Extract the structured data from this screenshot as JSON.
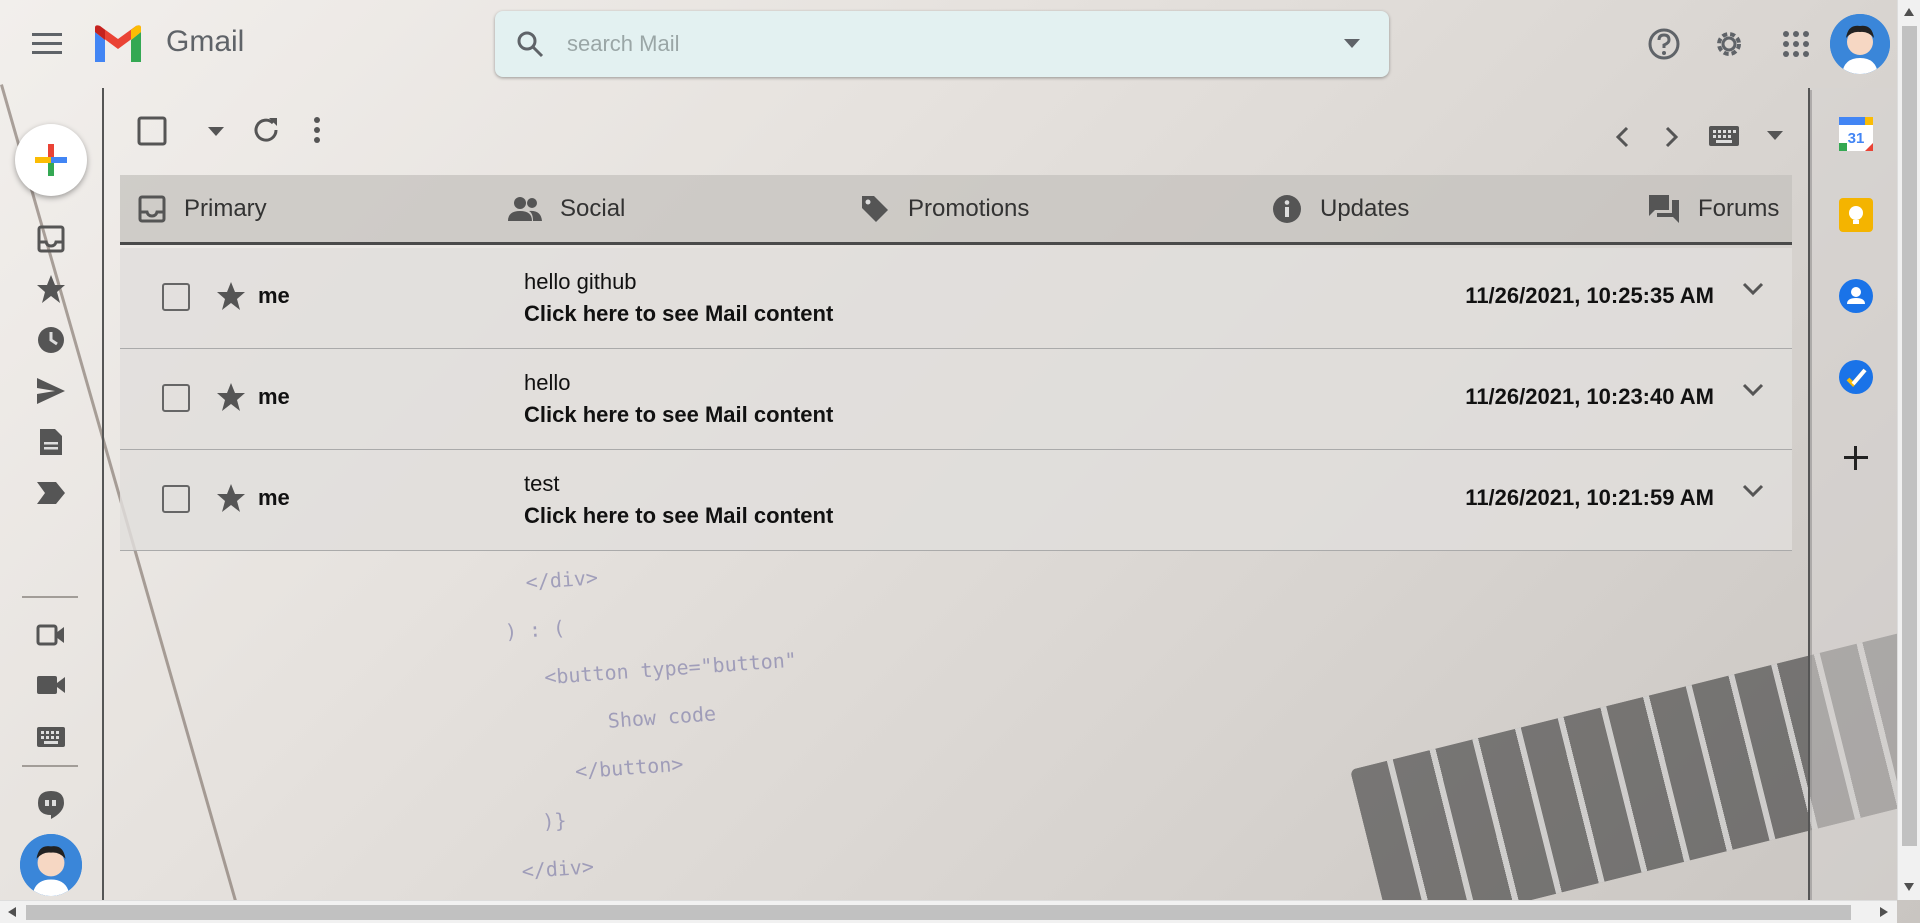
{
  "app": {
    "name": "Gmail"
  },
  "search": {
    "placeholder": "search Mail"
  },
  "tabs": [
    {
      "label": "Primary",
      "icon": "inbox-icon"
    },
    {
      "label": "Social",
      "icon": "people-icon"
    },
    {
      "label": "Promotions",
      "icon": "tag-icon"
    },
    {
      "label": "Updates",
      "icon": "info-icon"
    },
    {
      "label": "Forums",
      "icon": "forum-icon"
    }
  ],
  "emails": [
    {
      "from": "me",
      "subject": "hello github",
      "snippet": "Click here to see Mail content",
      "date": "11/26/2021, 10:25:35 AM"
    },
    {
      "from": "me",
      "subject": "hello",
      "snippet": "Click here to see Mail content",
      "date": "11/26/2021, 10:23:40 AM"
    },
    {
      "from": "me",
      "subject": "test",
      "snippet": "Click here to see Mail content",
      "date": "11/26/2021, 10:21:59 AM"
    }
  ],
  "calendar": {
    "day": "31"
  },
  "colors": {
    "accent": "#1a73e8",
    "keep": "#f4b400",
    "tasks": "#1a73e8",
    "search_bg": "#e3f1f1"
  }
}
